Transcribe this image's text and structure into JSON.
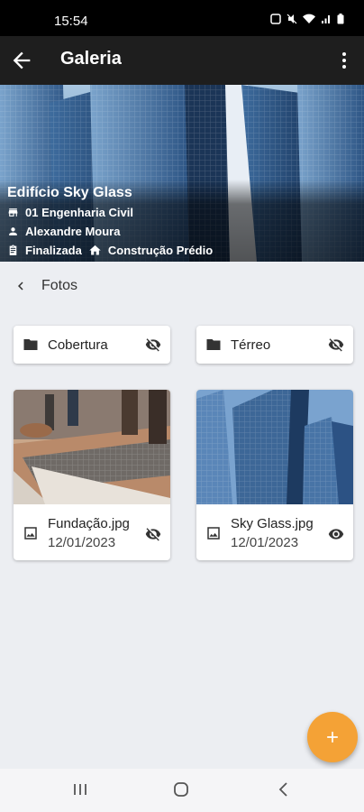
{
  "status_bar": {
    "time": "15:54"
  },
  "app_bar": {
    "title": "Galeria"
  },
  "project": {
    "name": "Edifício Sky Glass",
    "company": "01 Engenharia Civil",
    "responsible": "Alexandre Moura",
    "status": "Finalizada",
    "type": "Construção Prédio"
  },
  "section": {
    "title": "Fotos"
  },
  "folders": [
    {
      "label": "Cobertura",
      "visibility_icon": "eye-off-icon"
    },
    {
      "label": "Térreo",
      "visibility_icon": "eye-off-icon"
    }
  ],
  "photos": [
    {
      "name": "Fundação.jpg",
      "date": "12/01/2023",
      "visibility_icon": "eye-off-icon"
    },
    {
      "name": "Sky Glass.jpg",
      "date": "12/01/2023",
      "visibility_icon": "eye-icon"
    }
  ],
  "colors": {
    "app_bar": "#1e1e1e",
    "fab": "#f4a236",
    "background": "#eceef2"
  }
}
